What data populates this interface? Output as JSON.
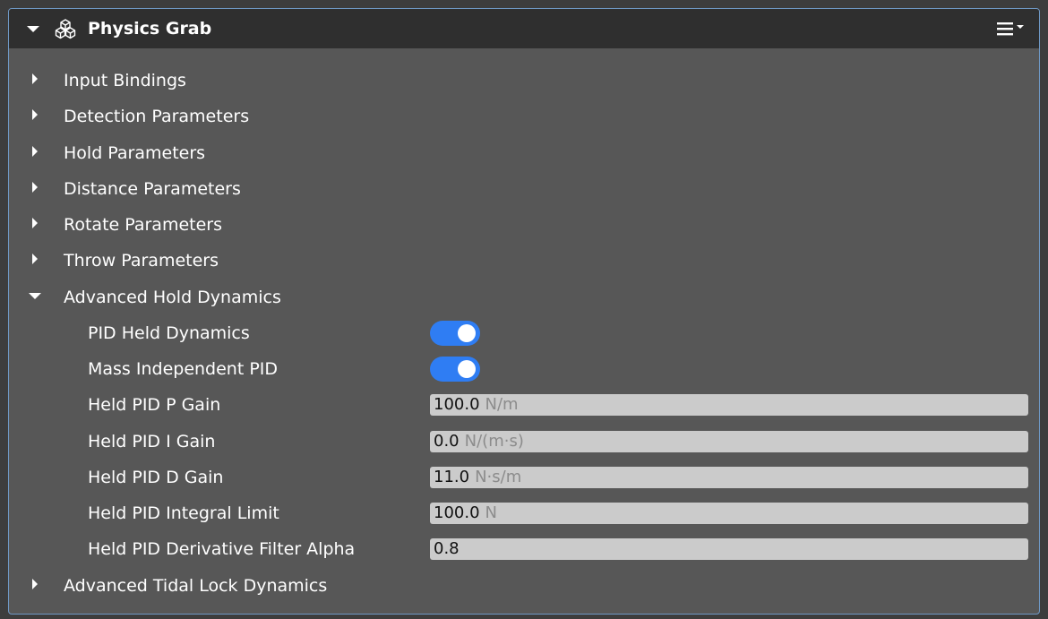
{
  "header": {
    "title": "Physics Grab",
    "component_icon": "cubes-icon",
    "menu_icon": "hamburger-menu-icon"
  },
  "colors": {
    "accent": "#2f7df3",
    "panel_bg": "#575757",
    "header_bg": "#2f2f2f",
    "border": "#6f98c4",
    "field_bg": "#cbcbcb"
  },
  "sections": [
    {
      "label": "Input Bindings",
      "expanded": false
    },
    {
      "label": "Detection Parameters",
      "expanded": false
    },
    {
      "label": "Hold Parameters",
      "expanded": false
    },
    {
      "label": "Distance Parameters",
      "expanded": false
    },
    {
      "label": "Rotate Parameters",
      "expanded": false
    },
    {
      "label": "Throw Parameters",
      "expanded": false
    },
    {
      "label": "Advanced Hold Dynamics",
      "expanded": true
    },
    {
      "label": "Advanced Tidal Lock Dynamics",
      "expanded": false
    }
  ],
  "advanced_hold": {
    "pid_held_dynamics": {
      "label": "PID Held Dynamics",
      "on": true
    },
    "mass_independent_pid": {
      "label": "Mass Independent PID",
      "on": true
    },
    "p_gain": {
      "label": "Held PID P Gain",
      "value": "100.0",
      "unit": "N/m"
    },
    "i_gain": {
      "label": "Held PID I Gain",
      "value": "0.0",
      "unit": "N/(m·s)"
    },
    "d_gain": {
      "label": "Held PID D Gain",
      "value": "11.0",
      "unit": "N·s/m"
    },
    "integral_limit": {
      "label": "Held PID Integral Limit",
      "value": "100.0",
      "unit": "N"
    },
    "derivative_alpha": {
      "label": "Held PID Derivative Filter Alpha",
      "value": "0.8",
      "unit": ""
    }
  }
}
